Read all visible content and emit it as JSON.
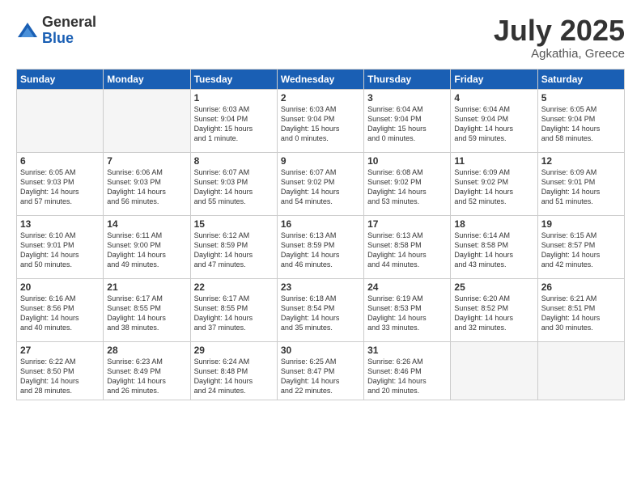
{
  "logo": {
    "general": "General",
    "blue": "Blue"
  },
  "title": "July 2025",
  "subtitle": "Agkathia, Greece",
  "headers": [
    "Sunday",
    "Monday",
    "Tuesday",
    "Wednesday",
    "Thursday",
    "Friday",
    "Saturday"
  ],
  "weeks": [
    [
      {
        "day": "",
        "info": ""
      },
      {
        "day": "",
        "info": ""
      },
      {
        "day": "1",
        "info": "Sunrise: 6:03 AM\nSunset: 9:04 PM\nDaylight: 15 hours\nand 1 minute."
      },
      {
        "day": "2",
        "info": "Sunrise: 6:03 AM\nSunset: 9:04 PM\nDaylight: 15 hours\nand 0 minutes."
      },
      {
        "day": "3",
        "info": "Sunrise: 6:04 AM\nSunset: 9:04 PM\nDaylight: 15 hours\nand 0 minutes."
      },
      {
        "day": "4",
        "info": "Sunrise: 6:04 AM\nSunset: 9:04 PM\nDaylight: 14 hours\nand 59 minutes."
      },
      {
        "day": "5",
        "info": "Sunrise: 6:05 AM\nSunset: 9:04 PM\nDaylight: 14 hours\nand 58 minutes."
      }
    ],
    [
      {
        "day": "6",
        "info": "Sunrise: 6:05 AM\nSunset: 9:03 PM\nDaylight: 14 hours\nand 57 minutes."
      },
      {
        "day": "7",
        "info": "Sunrise: 6:06 AM\nSunset: 9:03 PM\nDaylight: 14 hours\nand 56 minutes."
      },
      {
        "day": "8",
        "info": "Sunrise: 6:07 AM\nSunset: 9:03 PM\nDaylight: 14 hours\nand 55 minutes."
      },
      {
        "day": "9",
        "info": "Sunrise: 6:07 AM\nSunset: 9:02 PM\nDaylight: 14 hours\nand 54 minutes."
      },
      {
        "day": "10",
        "info": "Sunrise: 6:08 AM\nSunset: 9:02 PM\nDaylight: 14 hours\nand 53 minutes."
      },
      {
        "day": "11",
        "info": "Sunrise: 6:09 AM\nSunset: 9:02 PM\nDaylight: 14 hours\nand 52 minutes."
      },
      {
        "day": "12",
        "info": "Sunrise: 6:09 AM\nSunset: 9:01 PM\nDaylight: 14 hours\nand 51 minutes."
      }
    ],
    [
      {
        "day": "13",
        "info": "Sunrise: 6:10 AM\nSunset: 9:01 PM\nDaylight: 14 hours\nand 50 minutes."
      },
      {
        "day": "14",
        "info": "Sunrise: 6:11 AM\nSunset: 9:00 PM\nDaylight: 14 hours\nand 49 minutes."
      },
      {
        "day": "15",
        "info": "Sunrise: 6:12 AM\nSunset: 8:59 PM\nDaylight: 14 hours\nand 47 minutes."
      },
      {
        "day": "16",
        "info": "Sunrise: 6:13 AM\nSunset: 8:59 PM\nDaylight: 14 hours\nand 46 minutes."
      },
      {
        "day": "17",
        "info": "Sunrise: 6:13 AM\nSunset: 8:58 PM\nDaylight: 14 hours\nand 44 minutes."
      },
      {
        "day": "18",
        "info": "Sunrise: 6:14 AM\nSunset: 8:58 PM\nDaylight: 14 hours\nand 43 minutes."
      },
      {
        "day": "19",
        "info": "Sunrise: 6:15 AM\nSunset: 8:57 PM\nDaylight: 14 hours\nand 42 minutes."
      }
    ],
    [
      {
        "day": "20",
        "info": "Sunrise: 6:16 AM\nSunset: 8:56 PM\nDaylight: 14 hours\nand 40 minutes."
      },
      {
        "day": "21",
        "info": "Sunrise: 6:17 AM\nSunset: 8:55 PM\nDaylight: 14 hours\nand 38 minutes."
      },
      {
        "day": "22",
        "info": "Sunrise: 6:17 AM\nSunset: 8:55 PM\nDaylight: 14 hours\nand 37 minutes."
      },
      {
        "day": "23",
        "info": "Sunrise: 6:18 AM\nSunset: 8:54 PM\nDaylight: 14 hours\nand 35 minutes."
      },
      {
        "day": "24",
        "info": "Sunrise: 6:19 AM\nSunset: 8:53 PM\nDaylight: 14 hours\nand 33 minutes."
      },
      {
        "day": "25",
        "info": "Sunrise: 6:20 AM\nSunset: 8:52 PM\nDaylight: 14 hours\nand 32 minutes."
      },
      {
        "day": "26",
        "info": "Sunrise: 6:21 AM\nSunset: 8:51 PM\nDaylight: 14 hours\nand 30 minutes."
      }
    ],
    [
      {
        "day": "27",
        "info": "Sunrise: 6:22 AM\nSunset: 8:50 PM\nDaylight: 14 hours\nand 28 minutes."
      },
      {
        "day": "28",
        "info": "Sunrise: 6:23 AM\nSunset: 8:49 PM\nDaylight: 14 hours\nand 26 minutes."
      },
      {
        "day": "29",
        "info": "Sunrise: 6:24 AM\nSunset: 8:48 PM\nDaylight: 14 hours\nand 24 minutes."
      },
      {
        "day": "30",
        "info": "Sunrise: 6:25 AM\nSunset: 8:47 PM\nDaylight: 14 hours\nand 22 minutes."
      },
      {
        "day": "31",
        "info": "Sunrise: 6:26 AM\nSunset: 8:46 PM\nDaylight: 14 hours\nand 20 minutes."
      },
      {
        "day": "",
        "info": ""
      },
      {
        "day": "",
        "info": ""
      }
    ]
  ]
}
